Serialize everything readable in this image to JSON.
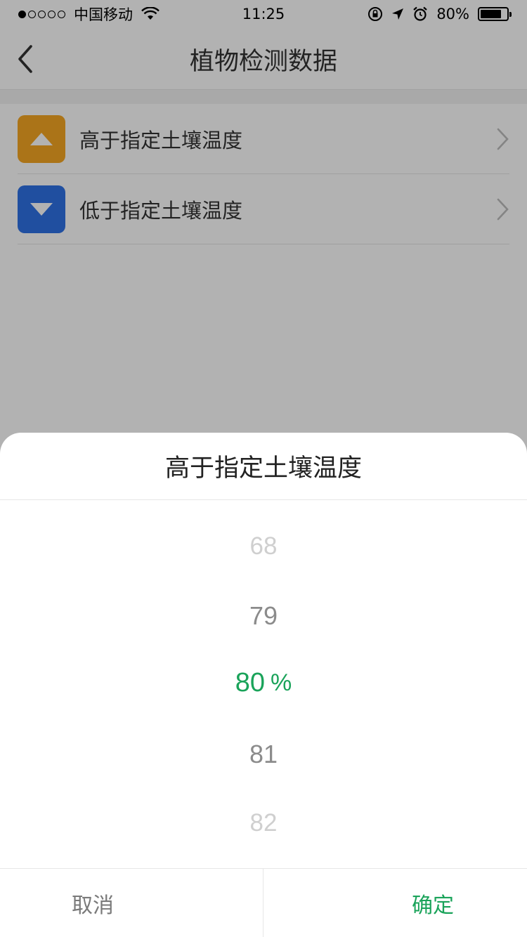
{
  "status_bar": {
    "carrier": "中国移动",
    "time": "11:25",
    "battery": "80%",
    "battery_level": 0.8,
    "signal_bars": 1,
    "icons": [
      "signal-dots-icon",
      "wifi-icon",
      "orientation-lock-icon",
      "location-icon",
      "alarm-icon",
      "battery-icon"
    ]
  },
  "navbar": {
    "title": "植物检测数据",
    "back_icon": "chevron-left-icon"
  },
  "list": {
    "items": [
      {
        "label": "高于指定土壤温度",
        "icon": "triangle-up-icon",
        "color": "#f5a623"
      },
      {
        "label": "低于指定土壤温度",
        "icon": "triangle-down-icon",
        "color": "#2f72e6"
      }
    ],
    "chevron_icon": "chevron-right-icon"
  },
  "sheet": {
    "title": "高于指定土壤温度",
    "picker": {
      "options": [
        "68",
        "79",
        "80",
        "81",
        "82"
      ],
      "selected": "80",
      "unit": "%"
    },
    "cancel_label": "取消",
    "confirm_label": "确定"
  },
  "colors": {
    "accent_green": "#1aa35a",
    "overlay": "rgba(0,0,0,0.3)"
  }
}
